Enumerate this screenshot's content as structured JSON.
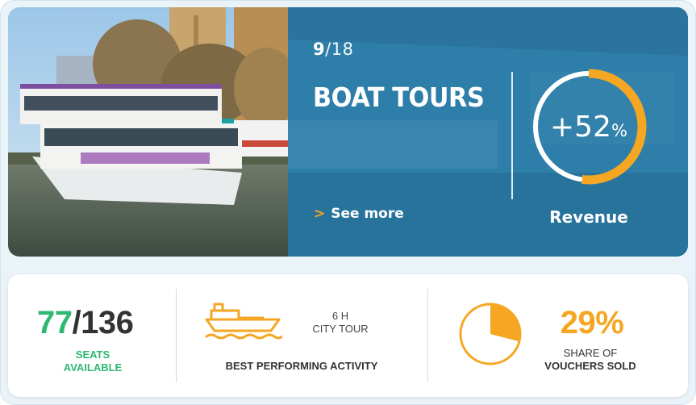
{
  "hero": {
    "counter": {
      "current": "9",
      "separator": "/",
      "total": "18"
    },
    "title": "BOAT TOURS",
    "see_more": {
      "chevron": ">",
      "label": "See more"
    },
    "gauge": {
      "value_text": "+52",
      "percent_sign": "%",
      "fraction": 0.52
    },
    "revenue_label": "Revenue",
    "photo_icon": "boat-photo"
  },
  "stats": {
    "seats": {
      "available": "77",
      "separator": "/",
      "total": "136",
      "label_line1": "SEATS",
      "label_line2": "AVAILABLE"
    },
    "activity": {
      "icon": "boat-icon",
      "duration": "6 H",
      "name": "CITY TOUR",
      "label": "BEST PERFORMING ACTIVITY"
    },
    "share": {
      "percent_text": "29%",
      "fraction": 0.29,
      "label_line1": "SHARE OF",
      "label_line2": "VOUCHERS SOLD"
    }
  },
  "colors": {
    "accent_orange": "#f5a623",
    "accent_green": "#2eb872",
    "overlay_blue": "#2c7fa9"
  }
}
